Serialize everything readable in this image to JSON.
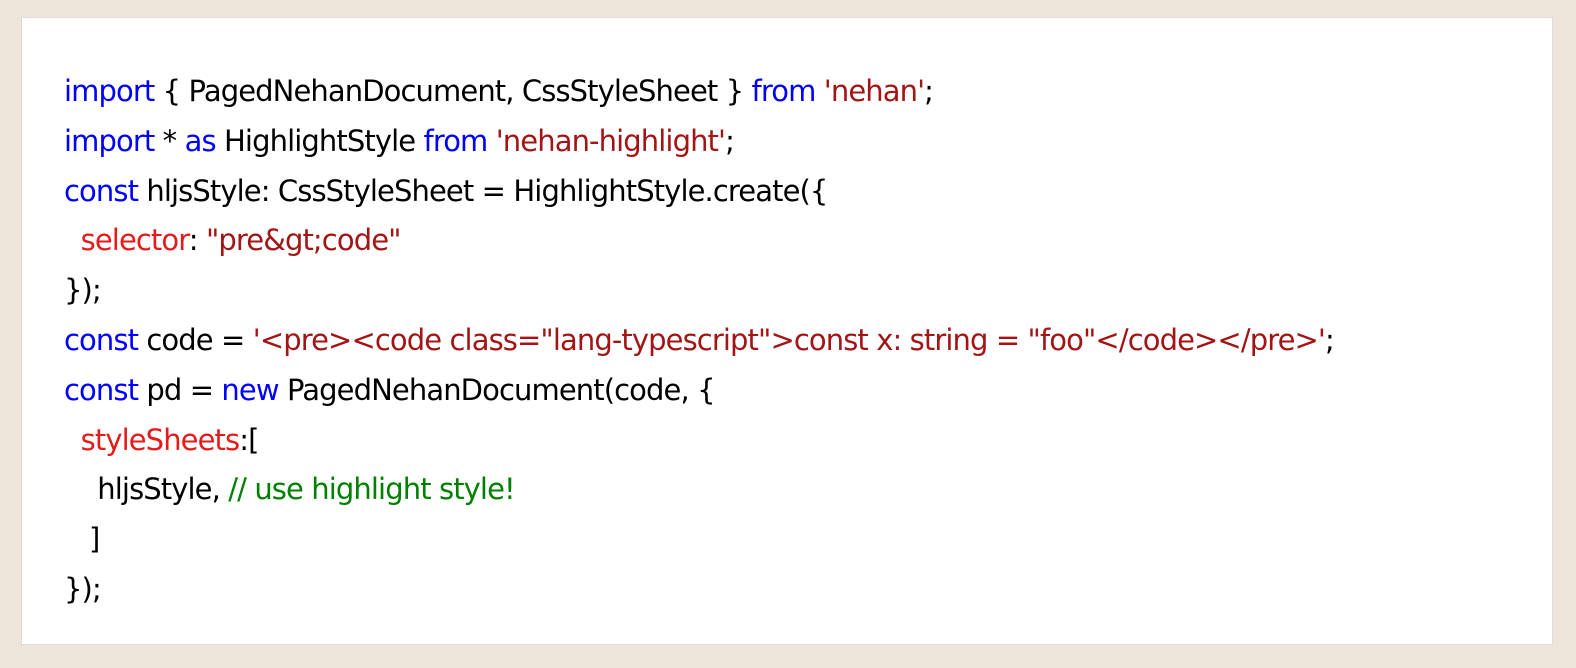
{
  "colors": {
    "page_background": "#ede5da",
    "panel_background": "#ffffff",
    "plain": "#000000",
    "keyword": "#0000ff",
    "string": "#a31515",
    "property": "#e31b1b",
    "comment": "#008000"
  },
  "code": {
    "lines": [
      [
        {
          "t": "import",
          "k": "kw"
        },
        {
          "t": " { PagedNehanDocument, CssStyleSheet } ",
          "k": "plain"
        },
        {
          "t": "from",
          "k": "kw"
        },
        {
          "t": " ",
          "k": "plain"
        },
        {
          "t": "'nehan'",
          "k": "str"
        },
        {
          "t": ";",
          "k": "plain"
        }
      ],
      [
        {
          "t": "import",
          "k": "kw"
        },
        {
          "t": " * ",
          "k": "plain"
        },
        {
          "t": "as",
          "k": "kw"
        },
        {
          "t": " HighlightStyle ",
          "k": "plain"
        },
        {
          "t": "from",
          "k": "kw"
        },
        {
          "t": " ",
          "k": "plain"
        },
        {
          "t": "'nehan-highlight'",
          "k": "str"
        },
        {
          "t": ";",
          "k": "plain"
        }
      ],
      [
        {
          "t": "const",
          "k": "kw"
        },
        {
          "t": " hljsStyle: CssStyleSheet = HighlightStyle.create({",
          "k": "plain"
        }
      ],
      [
        {
          "t": "  ",
          "k": "plain"
        },
        {
          "t": "selector",
          "k": "attr"
        },
        {
          "t": ": ",
          "k": "plain"
        },
        {
          "t": "\"pre&gt;code\"",
          "k": "str"
        }
      ],
      [
        {
          "t": "});",
          "k": "plain"
        }
      ],
      [
        {
          "t": "const",
          "k": "kw"
        },
        {
          "t": " code = ",
          "k": "plain"
        },
        {
          "t": "'<pre><code class=\"lang-typescript\">const x: string = \"foo\"</code></pre>'",
          "k": "str"
        },
        {
          "t": ";",
          "k": "plain"
        }
      ],
      [
        {
          "t": "const",
          "k": "kw"
        },
        {
          "t": " pd = ",
          "k": "plain"
        },
        {
          "t": "new",
          "k": "kw"
        },
        {
          "t": " PagedNehanDocument(code, {",
          "k": "plain"
        }
      ],
      [
        {
          "t": "  ",
          "k": "plain"
        },
        {
          "t": "styleSheets",
          "k": "attr"
        },
        {
          "t": ":[",
          "k": "plain"
        }
      ],
      [
        {
          "t": "    hljsStyle, ",
          "k": "plain"
        },
        {
          "t": "// use highlight style!",
          "k": "cmt"
        }
      ],
      [
        {
          "t": "   ]",
          "k": "plain"
        }
      ],
      [
        {
          "t": "});",
          "k": "plain"
        }
      ]
    ]
  }
}
